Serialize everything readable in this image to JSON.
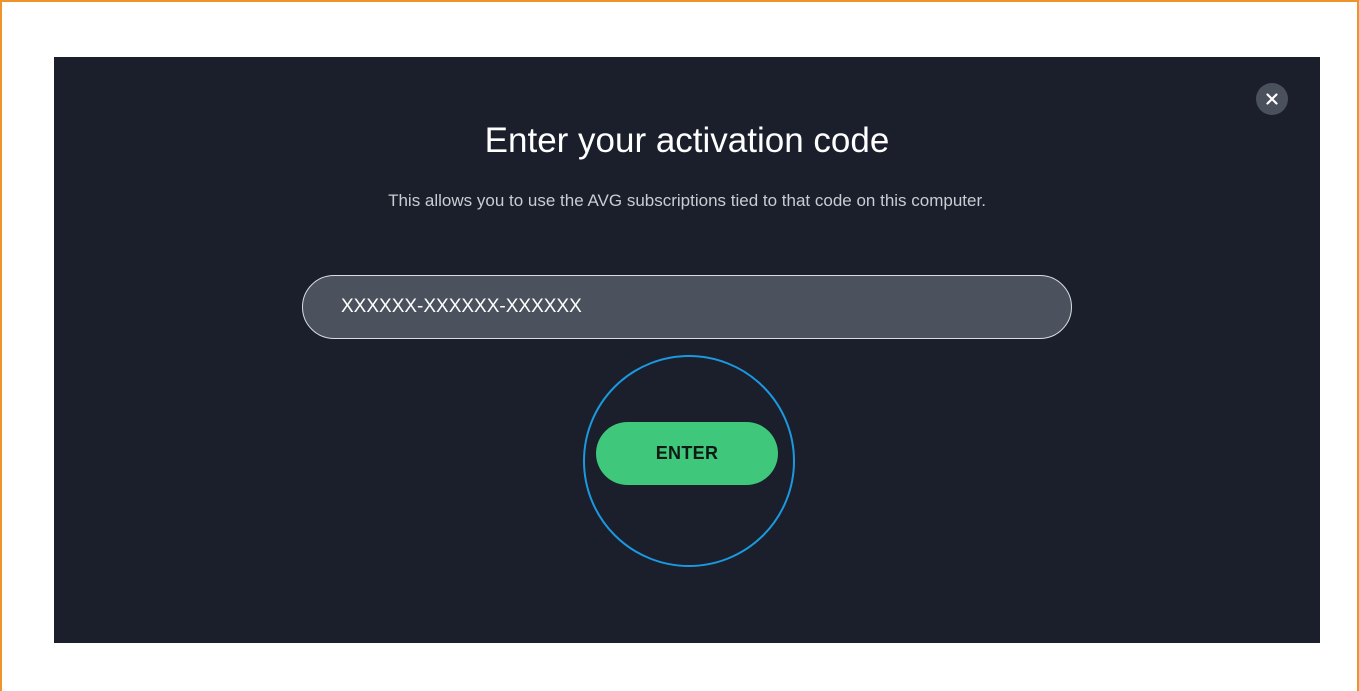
{
  "dialog": {
    "title": "Enter your activation code",
    "subtitle": "This allows you to use the AVG subscriptions tied to that code on this computer.",
    "close_icon": "close-icon"
  },
  "code_field": {
    "value": "XXXXXX-XXXXXX-XXXXXX",
    "placeholder": ""
  },
  "enter_button": {
    "label": "ENTER"
  },
  "colors": {
    "frame_border": "#f0932b",
    "dialog_background": "#1a1f2b",
    "input_background": "#4b525d",
    "accent_green": "#3fc77c",
    "highlight_circle": "#1a98e0"
  }
}
